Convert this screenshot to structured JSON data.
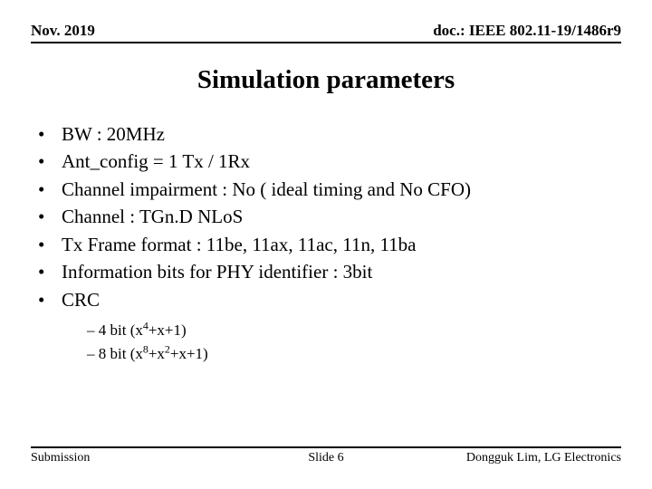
{
  "header": {
    "date": "Nov. 2019",
    "doc": "doc.: IEEE 802.11-19/1486r9"
  },
  "title": "Simulation parameters",
  "bullets": [
    "BW : 20MHz",
    "Ant_config = 1 Tx / 1Rx",
    "Channel impairment : No ( ideal timing and No CFO)",
    "Channel : TGn.D NLoS",
    "Tx Frame format : 11be, 11ax, 11ac, 11n, 11ba",
    "Information bits for PHY identifier : 3bit",
    "CRC"
  ],
  "subbullets": [
    {
      "prefix": "4 bit (x",
      "sup": "4",
      "suffix": "+x+1)"
    },
    {
      "prefix": "8 bit (x",
      "sup": "8",
      "mid": "+x",
      "sup2": "2",
      "suffix": "+x+1)"
    }
  ],
  "footer": {
    "left": "Submission",
    "center": "Slide 6",
    "right": "Dongguk Lim, LG Electronics"
  }
}
